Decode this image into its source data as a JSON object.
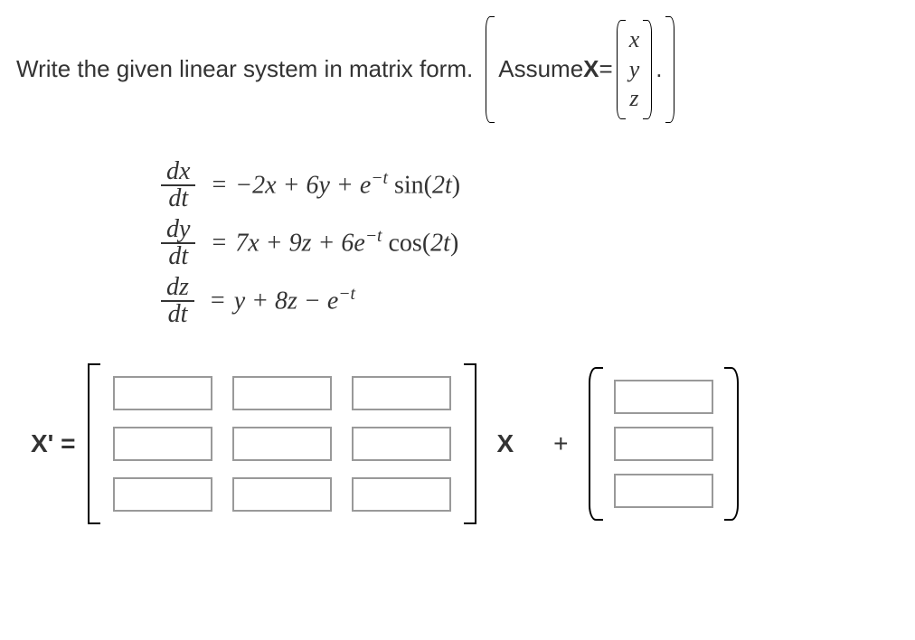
{
  "question": {
    "prefix": "Write the given linear system in matrix form.",
    "assume_prefix": "Assume ",
    "X_symbol": "X",
    "equals": " = ",
    "vec": [
      "x",
      "y",
      "z"
    ],
    "period": "."
  },
  "equations": {
    "rows": [
      {
        "num": "dx",
        "den": "dt",
        "rhs_html": "&minus;2<i>x</i> + 6<i>y</i> + <i>e</i><span class='sup'>&minus;t</span> <span class='norm'>sin(</span>2<i>t</i><span class='norm'>)</span>"
      },
      {
        "num": "dy",
        "den": "dt",
        "rhs_html": "7<i>x</i> + 9<i>z</i> + 6<i>e</i><span class='sup'>&minus;t</span> <span class='norm'>cos(</span>2<i>t</i><span class='norm'>)</span>"
      },
      {
        "num": "dz",
        "den": "dt",
        "rhs_html": "<i>y</i> + 8<i>z</i> &minus; <i>e</i><span class='sup'>&minus;t</span>"
      }
    ]
  },
  "answer": {
    "lhs": "X' =",
    "X_symbol": "X",
    "plus": "+"
  },
  "chart_data": {
    "type": "table",
    "note": "matrix form X' = A X + f(t)",
    "coefficient_matrix_blank": [
      [
        "",
        "",
        ""
      ],
      [
        "",
        "",
        ""
      ],
      [
        "",
        "",
        ""
      ]
    ],
    "forcing_vector_blank": [
      "",
      "",
      ""
    ]
  }
}
